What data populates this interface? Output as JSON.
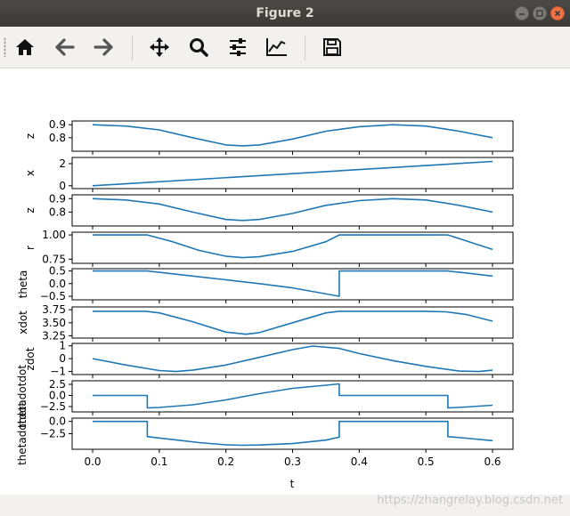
{
  "window": {
    "title": "Figure 2"
  },
  "toolbar": {
    "buttons": [
      {
        "name": "home-icon"
      },
      {
        "name": "back-arrow-icon"
      },
      {
        "name": "forward-arrow-icon"
      },
      {
        "name": "pan-icon"
      },
      {
        "name": "zoom-icon"
      },
      {
        "name": "configure-subplots-icon"
      },
      {
        "name": "edit-axis-icon"
      },
      {
        "name": "save-icon"
      }
    ]
  },
  "watermark": "https://zhangrelay.blog.csdn.net",
  "colors": {
    "line": "#1f77b4"
  },
  "chart_data": {
    "type": "line",
    "xlabel": "t",
    "xlim": [
      0.0,
      0.6
    ],
    "xticks": [
      "0.0",
      "0.1",
      "0.2",
      "0.3",
      "0.4",
      "0.5",
      "0.6"
    ],
    "panels": [
      {
        "ylabel": "z",
        "ylim": [
          0.71,
          0.915
        ],
        "yticks": [
          {
            "v": 0.9,
            "l": "0.9"
          },
          {
            "v": 0.8,
            "l": "0.8"
          }
        ],
        "x": [
          0,
          0.05,
          0.1,
          0.15,
          0.2,
          0.225,
          0.25,
          0.3,
          0.35,
          0.4,
          0.45,
          0.5,
          0.55,
          0.6
        ],
        "y": [
          0.9,
          0.89,
          0.86,
          0.8,
          0.745,
          0.738,
          0.745,
          0.79,
          0.85,
          0.885,
          0.9,
          0.89,
          0.85,
          0.8
        ]
      },
      {
        "ylabel": "x",
        "ylim": [
          -0.1,
          2.4
        ],
        "yticks": [
          {
            "v": 2,
            "l": "2"
          },
          {
            "v": 0,
            "l": "0"
          }
        ],
        "x": [
          0,
          0.6
        ],
        "y": [
          0.0,
          2.2
        ]
      },
      {
        "ylabel": "z",
        "ylim": [
          0.71,
          0.915
        ],
        "yticks": [
          {
            "v": 0.9,
            "l": "0.9"
          },
          {
            "v": 0.8,
            "l": "0.8"
          }
        ],
        "x": [
          0,
          0.05,
          0.1,
          0.15,
          0.2,
          0.225,
          0.25,
          0.3,
          0.35,
          0.4,
          0.45,
          0.5,
          0.55,
          0.6
        ],
        "y": [
          0.9,
          0.89,
          0.86,
          0.8,
          0.745,
          0.738,
          0.745,
          0.79,
          0.85,
          0.885,
          0.9,
          0.89,
          0.85,
          0.8
        ]
      },
      {
        "ylabel": "r",
        "ylim": [
          0.725,
          1.01
        ],
        "yticks": [
          {
            "v": 1.0,
            "l": "1.00"
          },
          {
            "v": 0.75,
            "l": "0.75"
          }
        ],
        "x": [
          0,
          0.082,
          0.12,
          0.16,
          0.2,
          0.225,
          0.25,
          0.3,
          0.35,
          0.37,
          0.4,
          0.45,
          0.5,
          0.533,
          0.56,
          0.6
        ],
        "y": [
          1.0,
          1.0,
          0.93,
          0.84,
          0.78,
          0.765,
          0.775,
          0.83,
          0.93,
          1.0,
          1.0,
          1.0,
          1.0,
          1.0,
          0.94,
          0.85
        ]
      },
      {
        "ylabel": "theta",
        "ylim": [
          -0.57,
          0.52
        ],
        "yticks": [
          {
            "v": 0.5,
            "l": "0.5"
          },
          {
            "v": 0.0,
            "l": "0.0"
          },
          {
            "v": -0.5,
            "l": "−0.5"
          }
        ],
        "x": [
          0,
          0.082,
          0.15,
          0.2,
          0.25,
          0.3,
          0.37,
          0.37,
          0.45,
          0.533,
          0.56,
          0.6
        ],
        "y": [
          0.5,
          0.5,
          0.3,
          0.15,
          0.0,
          -0.17,
          -0.5,
          0.5,
          0.5,
          0.5,
          0.42,
          0.3
        ]
      },
      {
        "ylabel": "xdot",
        "ylim": [
          3.24,
          3.77
        ],
        "yticks": [
          {
            "v": 3.75,
            "l": "3.75"
          },
          {
            "v": 3.5,
            "l": "3.50"
          },
          {
            "v": 3.25,
            "l": "3.25"
          }
        ],
        "x": [
          0,
          0.08,
          0.1,
          0.15,
          0.2,
          0.23,
          0.25,
          0.3,
          0.35,
          0.37,
          0.4,
          0.45,
          0.5,
          0.53,
          0.56,
          0.6
        ],
        "y": [
          3.72,
          3.72,
          3.69,
          3.52,
          3.32,
          3.28,
          3.31,
          3.5,
          3.69,
          3.72,
          3.72,
          3.72,
          3.72,
          3.71,
          3.66,
          3.53
        ]
      },
      {
        "ylabel": "zdot",
        "ylim": [
          -1.1,
          1.05
        ],
        "yticks": [
          {
            "v": 1,
            "l": "1"
          },
          {
            "v": 0,
            "l": "0"
          },
          {
            "v": -1,
            "l": "−1"
          }
        ],
        "x": [
          0,
          0.05,
          0.1,
          0.125,
          0.15,
          0.2,
          0.25,
          0.3,
          0.33,
          0.37,
          0.4,
          0.45,
          0.5,
          0.55,
          0.58,
          0.6
        ],
        "y": [
          0.0,
          -0.5,
          -0.93,
          -1.0,
          -0.9,
          -0.5,
          0.1,
          0.7,
          0.98,
          0.8,
          0.4,
          -0.15,
          -0.6,
          -0.97,
          -1.0,
          -0.9
        ]
      },
      {
        "ylabel": "thetadotdot",
        "ylim": [
          -3.3,
          2.9
        ],
        "yticks": [
          {
            "v": 2.5,
            "l": "2.5"
          },
          {
            "v": 0.0,
            "l": "0.0"
          },
          {
            "v": -2.5,
            "l": "−2.5"
          }
        ],
        "x": [
          0,
          0.082,
          0.082,
          0.1,
          0.15,
          0.2,
          0.25,
          0.3,
          0.35,
          0.37,
          0.37,
          0.45,
          0.533,
          0.533,
          0.56,
          0.6
        ],
        "y": [
          0.0,
          0.0,
          -2.8,
          -2.7,
          -2.1,
          -1.0,
          0.4,
          1.6,
          2.3,
          2.6,
          0.0,
          0.0,
          0.0,
          -2.8,
          -2.6,
          -2.2
        ]
      },
      {
        "ylabel": "thetadotdot",
        "ylim": [
          -5.3,
          0.3
        ],
        "yticks": [
          {
            "v": 0.0,
            "l": "0.0"
          },
          {
            "v": -2.5,
            "l": "−2.5"
          }
        ],
        "x": [
          0,
          0.082,
          0.082,
          0.12,
          0.16,
          0.2,
          0.225,
          0.25,
          0.3,
          0.35,
          0.37,
          0.37,
          0.45,
          0.533,
          0.533,
          0.56,
          0.6
        ],
        "y": [
          0.0,
          0.0,
          -3.1,
          -3.7,
          -4.3,
          -4.75,
          -4.85,
          -4.8,
          -4.5,
          -3.8,
          -3.2,
          0.0,
          0.0,
          0.0,
          -3.1,
          -3.4,
          -3.9
        ]
      }
    ]
  }
}
